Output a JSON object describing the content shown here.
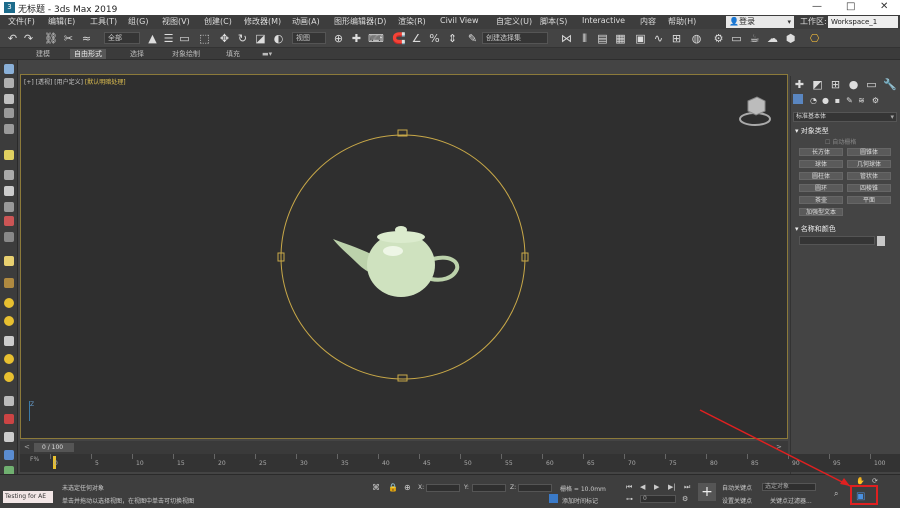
{
  "window": {
    "title": "无标题 - 3ds Max 2019",
    "logo": "3",
    "minimize": "—",
    "maximize": "□",
    "close": "✕"
  },
  "menu": {
    "items": [
      "文件(F)",
      "编辑(E)",
      "工具(T)",
      "组(G)",
      "视图(V)",
      "创建(C)",
      "修改器(M)",
      "动画(A)",
      "图形编辑器(D)",
      "渲染(R)",
      "Civil View",
      "自定义(U)",
      "脚本(S)",
      "Interactive",
      "内容",
      "帮助(H)"
    ],
    "user": "登录",
    "workspace_label": "工作区:",
    "workspace": "Workspace_1"
  },
  "toolbar": {
    "select_filter": "全部",
    "ref_coord": "视图",
    "named_set": "创建选择集"
  },
  "ribbon": {
    "tabs": [
      "建模",
      "自由形式",
      "选择",
      "对象绘制",
      "填充"
    ]
  },
  "viewport": {
    "label_parts": [
      "[+]",
      "[透视]",
      "[用户定义]",
      "[默认明暗处理]"
    ],
    "axis_label": "Z",
    "colors": {
      "teapot": "#cfe2bf",
      "gizmo": "#c8a848",
      "background": "#2f2f2f"
    }
  },
  "command_panel": {
    "category": "标准基本体",
    "object_type_title": "对象类型",
    "autogrid": "自动栅格",
    "buttons": [
      "长方体",
      "圆锥体",
      "球体",
      "几何球体",
      "圆柱体",
      "管状体",
      "圆环",
      "四棱锥",
      "茶壶",
      "平面",
      "加强型文本"
    ],
    "name_color_title": "名称和颜色"
  },
  "timeline": {
    "frame_counter": "0 / 100",
    "ticks": [
      "0",
      "5",
      "10",
      "15",
      "20",
      "25",
      "30",
      "35",
      "40",
      "45",
      "50",
      "55",
      "60",
      "65",
      "70",
      "75",
      "80",
      "85",
      "90",
      "95",
      "100"
    ]
  },
  "statusbar": {
    "maxscript_label": "Testing for AE",
    "prompt1": "未选定任何对象",
    "prompt2": "单击并拖动以选择视图，在视图中单击可切换视图",
    "x_label": "X:",
    "y_label": "Y:",
    "z_label": "Z:",
    "grid": "栅格 = 10.0mm",
    "add_time_tag": "添加时间标记",
    "auto_key": "自动关键点",
    "selected_set": "选定对象",
    "set_key": "设置关键点",
    "key_filters": "关键点过滤器...",
    "frame_value": "0"
  }
}
